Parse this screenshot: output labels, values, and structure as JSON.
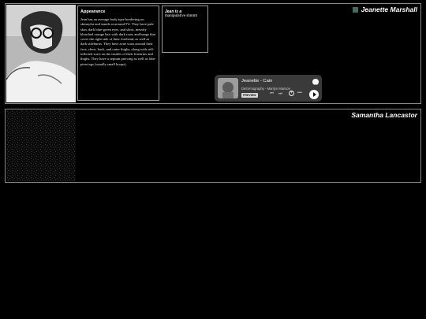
{
  "character1": {
    "name": "Jeanette Marshall",
    "accent_color": "#3e6e68",
    "appearance_title": "Appearance",
    "appearance_text": "Jean has an average body type bordering on skinnyfat and stands at around 5'4. They have pale skin, dark blue-green eyes, and short, messily bleached orange hair with dark roots and bangs that cover the right side of their forehead, as well as dark sideburns. They have acne scars around their face, chest, back, and outer thighs, along with self-inflicted scars on the insides of their forearms and thighs. They have a septum piercing as well as lobe piercings (usually small hoops).",
    "quote_heading": "Jean is a",
    "quote_text": "manipulative shmmt",
    "player": {
      "track": "Jeanette - Cain",
      "artist": "Deformography - Marilyn Manson",
      "badge": "PREVIEW"
    }
  },
  "character2": {
    "name": "Samantha Lancastor"
  }
}
